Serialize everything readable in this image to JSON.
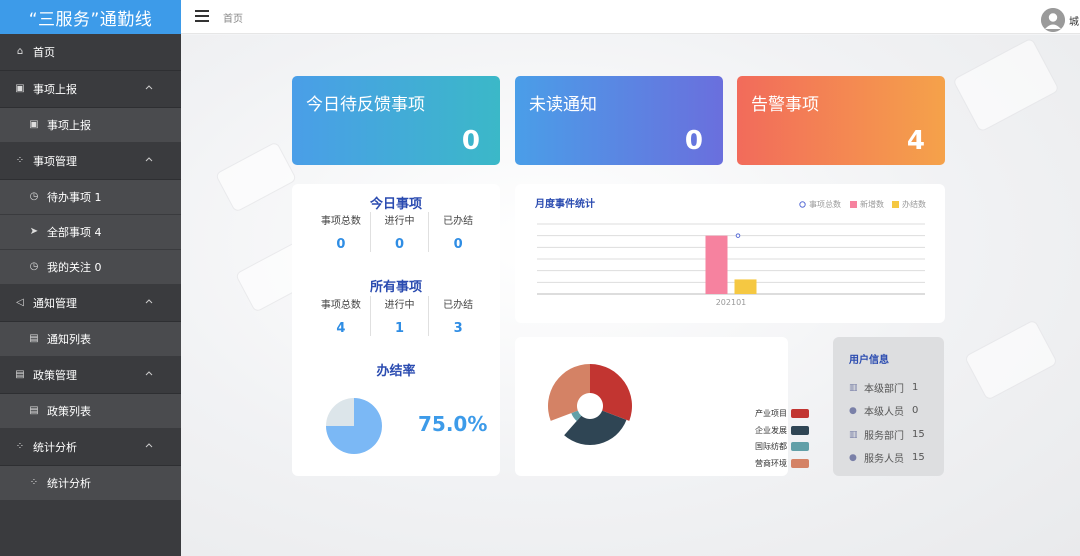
{
  "app": {
    "title": "“三服务”通勤线"
  },
  "header": {
    "breadcrumb": "首页",
    "user": "城"
  },
  "sidebar": {
    "items": [
      {
        "label": "首页",
        "icon": "home-icon"
      },
      {
        "label": "事项上报",
        "icon": "upload-icon",
        "children": [
          {
            "label": "事项上报",
            "icon": "upload-icon"
          }
        ]
      },
      {
        "label": "事项管理",
        "icon": "grid-icon",
        "children": [
          {
            "label": "待办事项 1",
            "icon": "alarm-icon"
          },
          {
            "label": "全部事项 4",
            "icon": "send-icon"
          },
          {
            "label": "我的关注 0",
            "icon": "alarm-icon"
          }
        ]
      },
      {
        "label": "通知管理",
        "icon": "speaker-icon",
        "children": [
          {
            "label": "通知列表",
            "icon": "doc-icon"
          }
        ]
      },
      {
        "label": "政策管理",
        "icon": "doc-icon",
        "children": [
          {
            "label": "政策列表",
            "icon": "doc-icon"
          }
        ]
      },
      {
        "label": "统计分析",
        "icon": "grid-icon",
        "children": [
          {
            "label": "统计分析",
            "icon": "grid-icon"
          }
        ]
      }
    ]
  },
  "cards": {
    "feedback": {
      "title": "今日待反馈事项",
      "value": "0"
    },
    "unread": {
      "title": "未读通知",
      "value": "0"
    },
    "alert": {
      "title": "告警事项",
      "value": "4"
    }
  },
  "today": {
    "title": "今日事项",
    "labels": [
      "事项总数",
      "进行中",
      "已办结"
    ],
    "values": [
      "0",
      "0",
      "0"
    ]
  },
  "all": {
    "title": "所有事项",
    "labels": [
      "事项总数",
      "进行中",
      "已办结"
    ],
    "values": [
      "4",
      "1",
      "3"
    ]
  },
  "rate": {
    "title": "办结率",
    "value": "75.0%",
    "fraction": 0.75
  },
  "monthly": {
    "title": "月度事件统计",
    "legend": [
      "事项总数",
      "新增数",
      "办结数"
    ]
  },
  "user_info": {
    "title": "用户信息",
    "rows": [
      {
        "label": "本级部门",
        "value": "1"
      },
      {
        "label": "本级人员",
        "value": "0"
      },
      {
        "label": "服务部门",
        "value": "15"
      },
      {
        "label": "服务人员",
        "value": "15"
      }
    ]
  },
  "colors": {
    "sidebar": "#3a3b3e",
    "logo": "#3d9be9",
    "accent": "#2a4bb0"
  },
  "chart_data": [
    {
      "type": "bar",
      "title": "月度事件统计",
      "categories": [
        "202101"
      ],
      "series": [
        {
          "name": "事项总数",
          "values": [
            4
          ],
          "color": "#5b6fd6",
          "kind": "line"
        },
        {
          "name": "新增数",
          "values": [
            4
          ],
          "color": "#f6829f"
        },
        {
          "name": "办结数",
          "values": [
            1
          ],
          "color": "#f5c842"
        }
      ],
      "ylim": [
        0,
        4.8
      ],
      "grid": true,
      "legend": "top-right"
    },
    {
      "type": "pie",
      "labels": [
        "产业项目",
        "企业发展",
        "国际纺都",
        "营商环境"
      ],
      "values": [
        1,
        1,
        0.25,
        1
      ],
      "colors": [
        "#c23531",
        "#2f4554",
        "#61a0a8",
        "#d48265"
      ],
      "legend": "right"
    },
    {
      "type": "pie",
      "labels": [
        "办结率"
      ],
      "values": [
        75,
        25
      ],
      "colors": [
        "#7bb8f5",
        "#dce5ea"
      ]
    }
  ]
}
